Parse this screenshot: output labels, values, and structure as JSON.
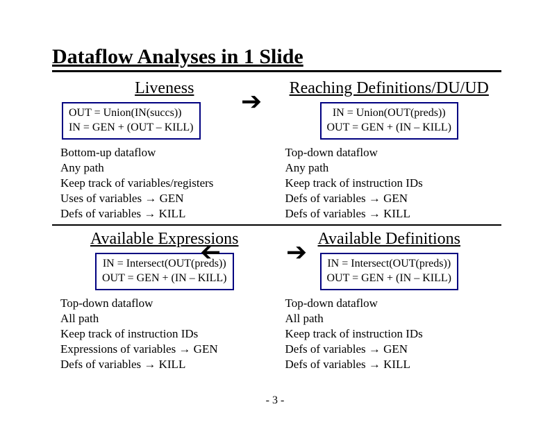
{
  "title": "Dataflow Analyses in 1 Slide",
  "page_number": "- 3 -",
  "arrows": {
    "right": "➔"
  },
  "quads": {
    "liveness": {
      "title": "Liveness",
      "eq1": "OUT = Union(IN(succs))",
      "eq2": "IN = GEN + (OUT – KILL)",
      "d1": "Bottom-up dataflow",
      "d2": "Any path",
      "d3": "Keep track of variables/registers",
      "d4": "Uses of variables → GEN",
      "d5": "Defs of variables → KILL"
    },
    "reaching": {
      "title": "Reaching Definitions/DU/UD",
      "eq1": "IN = Union(OUT(preds))",
      "eq2": "OUT = GEN + (IN – KILL)",
      "d1": "Top-down dataflow",
      "d2": "Any path",
      "d3": "Keep track of instruction IDs",
      "d4": "Defs of variables → GEN",
      "d5": "Defs of variables → KILL"
    },
    "avexpr": {
      "title": "Available Expressions",
      "eq1": "IN = Intersect(OUT(preds))",
      "eq2": "OUT = GEN + (IN – KILL)",
      "d1": "Top-down dataflow",
      "d2": "All path",
      "d3": "Keep track of instruction IDs",
      "d4": "Expressions of variables → GEN",
      "d5": "Defs of variables → KILL"
    },
    "avdef": {
      "title": "Available Definitions",
      "eq1": "IN = Intersect(OUT(preds))",
      "eq2": "OUT = GEN + (IN – KILL)",
      "d1": "Top-down dataflow",
      "d2": "All path",
      "d3": "Keep track of instruction IDs",
      "d4": "Defs of variables → GEN",
      "d5": "Defs of variables → KILL"
    }
  }
}
